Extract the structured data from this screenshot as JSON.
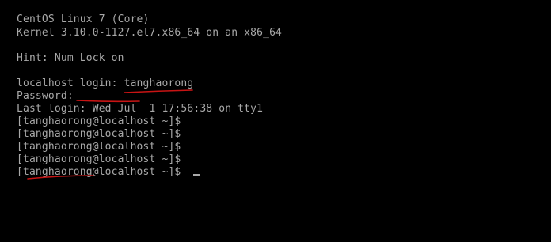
{
  "terminal": {
    "lines": [
      "CentOS Linux 7 (Core)",
      "Kernel 3.10.0-1127.el7.x86_64 on an x86_64",
      "",
      "Hint: Num Lock on",
      "",
      "localhost login: tanghaorong",
      "Password:",
      "Last login: Wed Jul  1 17:56:38 on tty1",
      "[tanghaorong@localhost ~]$",
      "[tanghaorong@localhost ~]$",
      "[tanghaorong@localhost ~]$",
      "[tanghaorong@localhost ~]$",
      "[tanghaorong@localhost ~]$ "
    ]
  },
  "colors": {
    "background": "#000000",
    "text": "#a8a8a8",
    "annotation": "#c81414"
  }
}
